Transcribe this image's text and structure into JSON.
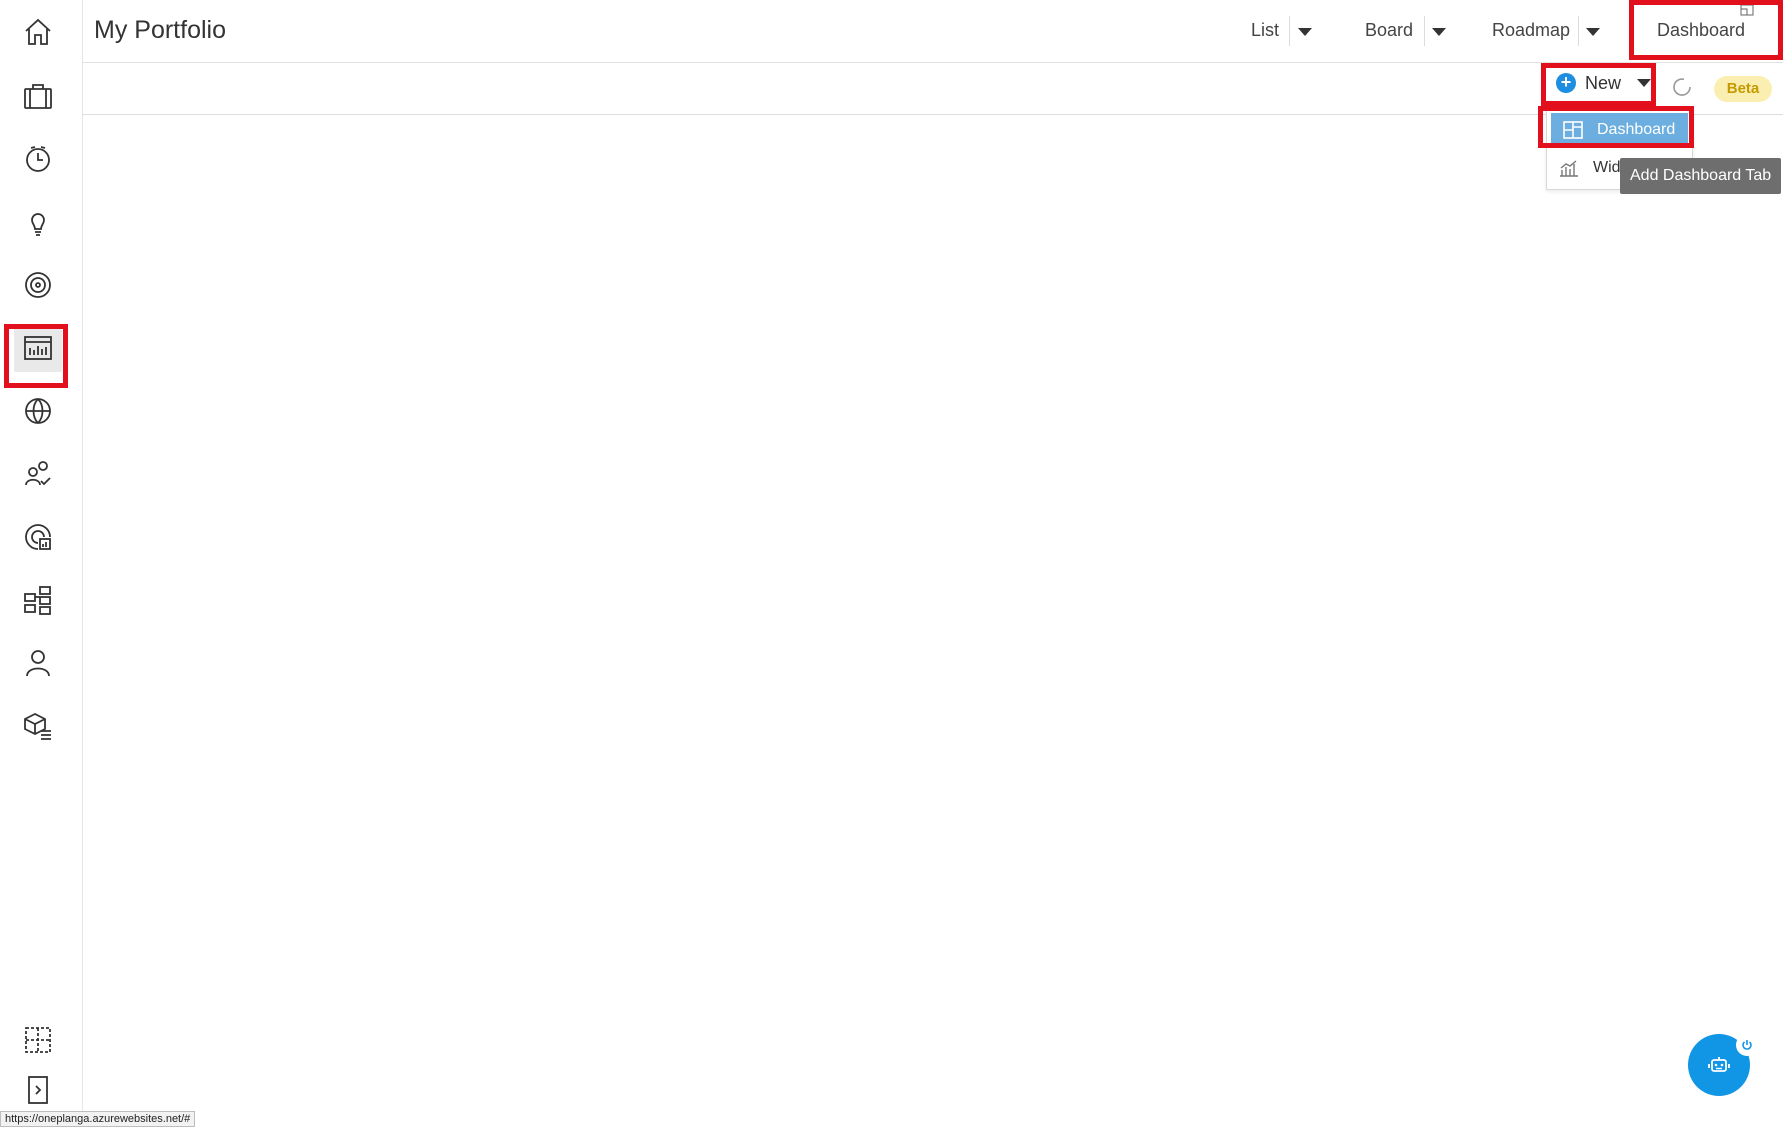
{
  "header": {
    "title": "My Portfolio",
    "views": [
      {
        "label": "List"
      },
      {
        "label": "Board"
      },
      {
        "label": "Roadmap"
      },
      {
        "label": "Dashboard"
      }
    ]
  },
  "toolbar": {
    "new_label": "New",
    "beta_label": "Beta"
  },
  "new_menu": {
    "items": [
      {
        "label": "Dashboard",
        "icon": "dashboard-layout-icon"
      },
      {
        "label": "Widg",
        "icon": "bar-chart-icon"
      }
    ]
  },
  "tooltip": "Add Dashboard Tab",
  "sidebar": {
    "items": [
      {
        "icon": "home-icon"
      },
      {
        "icon": "briefcase-icon"
      },
      {
        "icon": "timer-icon"
      },
      {
        "icon": "lightbulb-icon"
      },
      {
        "icon": "target-icon"
      },
      {
        "icon": "report-chart-icon"
      },
      {
        "icon": "globe-icon"
      },
      {
        "icon": "people-check-icon"
      },
      {
        "icon": "chart-target-icon"
      },
      {
        "icon": "hierarchy-icon"
      },
      {
        "icon": "user-icon"
      },
      {
        "icon": "package-list-icon"
      }
    ],
    "bottom": [
      {
        "icon": "layout-select-icon"
      },
      {
        "icon": "expand-sidebar-icon"
      }
    ]
  },
  "status_bar": {
    "url": "https://oneplanga.azurewebsites.net/#"
  },
  "colors": {
    "highlight": "#e1101c",
    "accent": "#1e8fe0",
    "menu_selected": "#6baedf",
    "beta_bg": "#fbeeb1"
  }
}
